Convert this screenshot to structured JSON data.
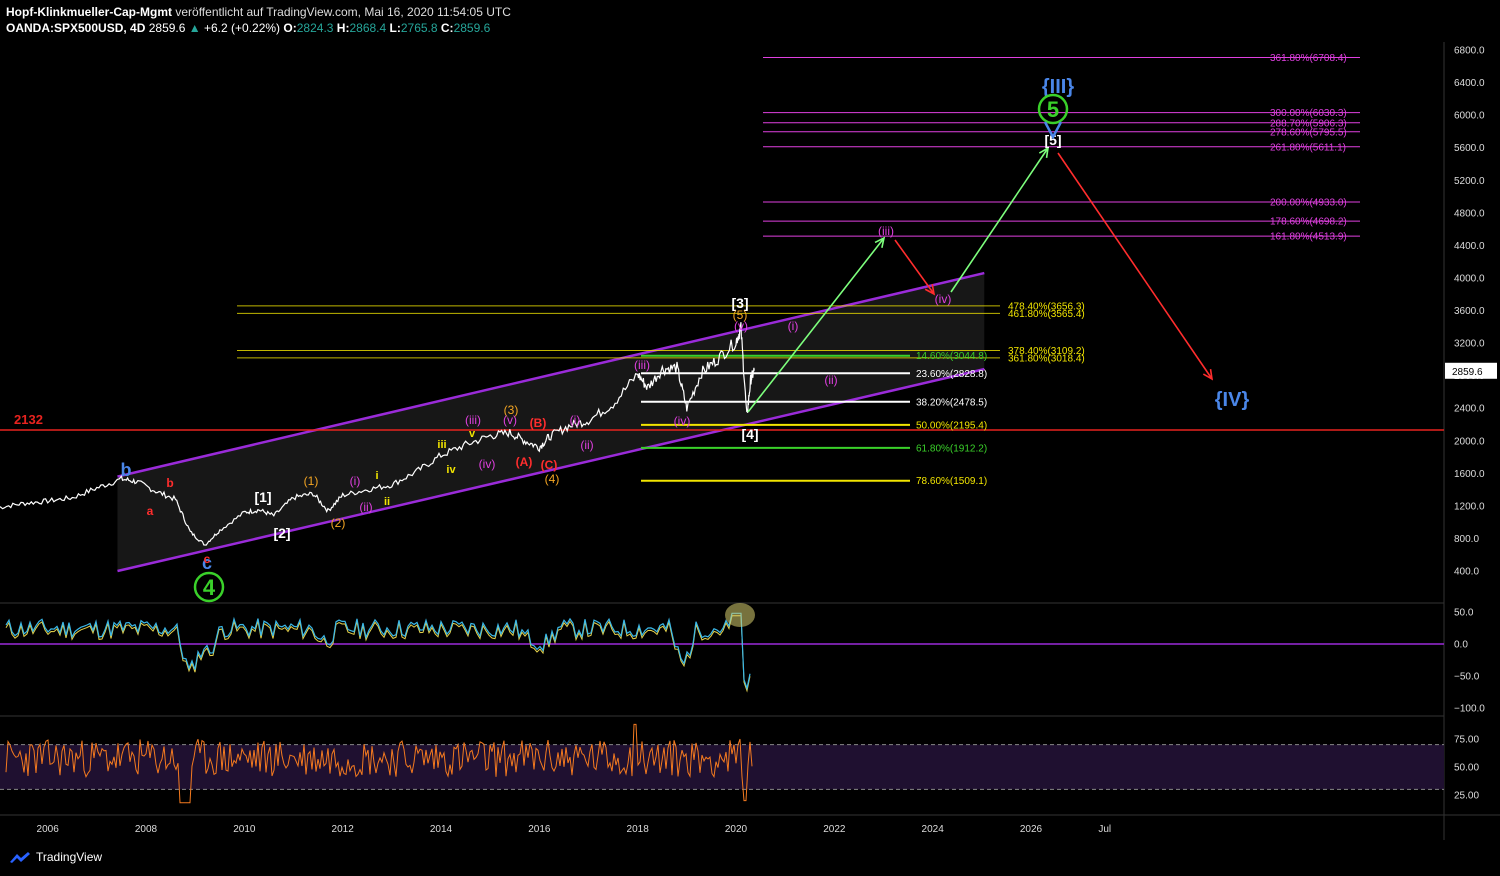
{
  "header": {
    "author": "Hopf-Klinkmueller-Cap-Mgmt",
    "published": "veröffentlicht auf TradingView.com, Mai 16, 2020 11:54:05 UTC",
    "symbol": "OANDA:SPX500USD, 4D",
    "last": "2859.6",
    "change": "+6.2 (+0.22%)",
    "o_label": "O:",
    "o": "2824.3",
    "h_label": "H:",
    "h": "2868.4",
    "l_label": "L:",
    "l": "2765.8",
    "c_label": "C:",
    "c": "2859.6"
  },
  "footer": {
    "brand": "TradingView"
  },
  "colors": {
    "background": "#000000",
    "price": "#ffffff",
    "channel": "#9a2bd9",
    "support": "#e8231f",
    "fib_magenta": "#e040e0",
    "fib_yellow": "#f2e500",
    "fib_green": "#3ad12a",
    "up_arrow": "#7dff7d",
    "down_arrow": "#ff2d2d",
    "oscillator": "#3ab8e8",
    "rsi": "#f47a1f",
    "last_price_bg": "#ffffff"
  },
  "chart_data": [
    {
      "type": "line",
      "title": "OANDA:SPX500USD, 4D",
      "x_ticks": [
        "2006",
        "2008",
        "2010",
        "2012",
        "2014",
        "2016",
        "2018",
        "2020",
        "2022",
        "2024",
        "2026",
        "Jul"
      ],
      "y_ticks": [
        "6800.0",
        "6400.0",
        "6000.0",
        "5600.0",
        "5200.0",
        "4800.0",
        "4400.0",
        "4000.0",
        "3600.0",
        "3200.0",
        "2800.0",
        "2400.0",
        "2000.0",
        "1600.0",
        "1200.0",
        "800.0",
        "400.0"
      ],
      "ylim": [
        150,
        6950
      ],
      "last_price_label": "2859.6",
      "series": [
        {
          "x": [
            2005.0,
            2005.5,
            2006.0,
            2006.5,
            2007.0,
            2007.5,
            2007.8,
            2008.2,
            2008.6,
            2008.9,
            2009.2,
            2009.5,
            2010.0,
            2010.3,
            2010.6,
            2011.0,
            2011.4,
            2011.7,
            2012.0,
            2012.5,
            2013.0,
            2013.5,
            2014.0,
            2014.5,
            2015.0,
            2015.4,
            2015.7,
            2016.0,
            2016.2,
            2016.6,
            2017.0,
            2017.5,
            2018.0,
            2018.2,
            2018.5,
            2018.8,
            2019.0,
            2019.3,
            2019.6,
            2020.0,
            2020.1,
            2020.22,
            2020.3,
            2020.37
          ],
          "y": [
            1180,
            1230,
            1260,
            1300,
            1420,
            1530,
            1500,
            1380,
            1280,
            880,
            720,
            900,
            1120,
            1150,
            1080,
            1300,
            1350,
            1140,
            1330,
            1400,
            1460,
            1620,
            1820,
            1950,
            2060,
            2100,
            2000,
            1920,
            2050,
            2180,
            2250,
            2450,
            2820,
            2650,
            2880,
            2900,
            2400,
            2840,
            2990,
            3220,
            3380,
            2300,
            2750,
            2860
          ]
        }
      ],
      "support_label": "2132",
      "support_value": 2132,
      "fib_right": [
        {
          "label": "361.80%(6708.4)",
          "value": 6708.4
        },
        {
          "label": "300.00%(6030.3)",
          "value": 6030.3
        },
        {
          "label": "288.70%(5906.3)",
          "value": 5906.3
        },
        {
          "label": "278.60%(5795.5)",
          "value": 5795.5
        },
        {
          "label": "261.80%(5611.1)",
          "value": 5611.1
        },
        {
          "label": "200.00%(4933.0)",
          "value": 4933.0
        },
        {
          "label": "178.60%(4698.2)",
          "value": 4698.2
        },
        {
          "label": "161.80%(4513.9)",
          "value": 4513.9
        }
      ],
      "fib_top": [
        {
          "label": "478.40%(3656.3)",
          "value": 3656.3
        },
        {
          "label": "461.80%(3565.4)",
          "value": 3565.4
        },
        {
          "label": "378.40%(3109.2)",
          "value": 3109.2
        },
        {
          "label": "361.80%(3018.4)",
          "value": 3018.4
        }
      ],
      "retracements": [
        {
          "label": "14.60%(3044.8)",
          "value": 3044.8,
          "color": "green"
        },
        {
          "label": "23.60%(2828.8)",
          "value": 2828.8,
          "color": "white"
        },
        {
          "label": "38.20%(2478.5)",
          "value": 2478.5,
          "color": "white"
        },
        {
          "label": "50.00%(2195.4)",
          "value": 2195.4,
          "color": "yellow"
        },
        {
          "label": "61.80%(1912.2)",
          "value": 1912.2,
          "color": "green"
        },
        {
          "label": "78.60%(1509.1)",
          "value": 1509.1,
          "color": "yellow"
        }
      ],
      "wave_labels": {
        "big": [
          {
            "text": "{III}",
            "color": "#4a86e8"
          },
          {
            "text": "{IV}",
            "color": "#4a86e8"
          }
        ],
        "white": [
          {
            "text": "[1]"
          },
          {
            "text": "[2]"
          },
          {
            "text": "[3]"
          },
          {
            "text": "[4]"
          },
          {
            "text": "[5]"
          }
        ],
        "circled": [
          {
            "text": "4",
            "color": "#3ad12a"
          },
          {
            "text": "5",
            "color": "#3ad12a"
          }
        ],
        "abc": [
          {
            "text": "b",
            "color": "#4a86e8"
          },
          {
            "text": "c",
            "color": "#4a86e8"
          },
          {
            "text": "a",
            "color": "#ff2d2d"
          },
          {
            "text": "b",
            "color": "#ff2d2d"
          },
          {
            "text": "c",
            "color": "#ff2d2d"
          },
          {
            "text": "(A)",
            "color": "#ff2d2d"
          },
          {
            "text": "(B)",
            "color": "#ff2d2d"
          },
          {
            "text": "(C)",
            "color": "#ff2d2d"
          }
        ],
        "orange": [
          {
            "text": "(1)"
          },
          {
            "text": "(2)"
          },
          {
            "text": "(3)"
          },
          {
            "text": "(4)"
          },
          {
            "text": "(5)"
          }
        ],
        "magenta": [
          {
            "text": "(i)"
          },
          {
            "text": "(ii)"
          },
          {
            "text": "(iii)"
          },
          {
            "text": "(iv)"
          },
          {
            "text": "(v)"
          },
          {
            "text": "(i)"
          },
          {
            "text": "(ii)"
          },
          {
            "text": "(iii)"
          },
          {
            "text": "(iv)"
          },
          {
            "text": "(v)"
          },
          {
            "text": "(i)"
          },
          {
            "text": "(ii)"
          },
          {
            "text": "(iii)"
          },
          {
            "text": "(iv)"
          }
        ],
        "yellow_small": [
          {
            "text": "i"
          },
          {
            "text": "ii"
          },
          {
            "text": "iii"
          },
          {
            "text": "iv"
          },
          {
            "text": "v"
          }
        ]
      }
    },
    {
      "type": "line",
      "title": "",
      "y_ticks": [
        "50.0",
        "0.0",
        "−50.0",
        "−100.0"
      ],
      "ylim": [
        -110,
        62
      ],
      "zero_line": 0
    },
    {
      "type": "line",
      "title": "",
      "y_ticks": [
        "75.00",
        "50.00",
        "25.00"
      ],
      "ylim": [
        12,
        95
      ],
      "bands": [
        30,
        70
      ]
    }
  ]
}
